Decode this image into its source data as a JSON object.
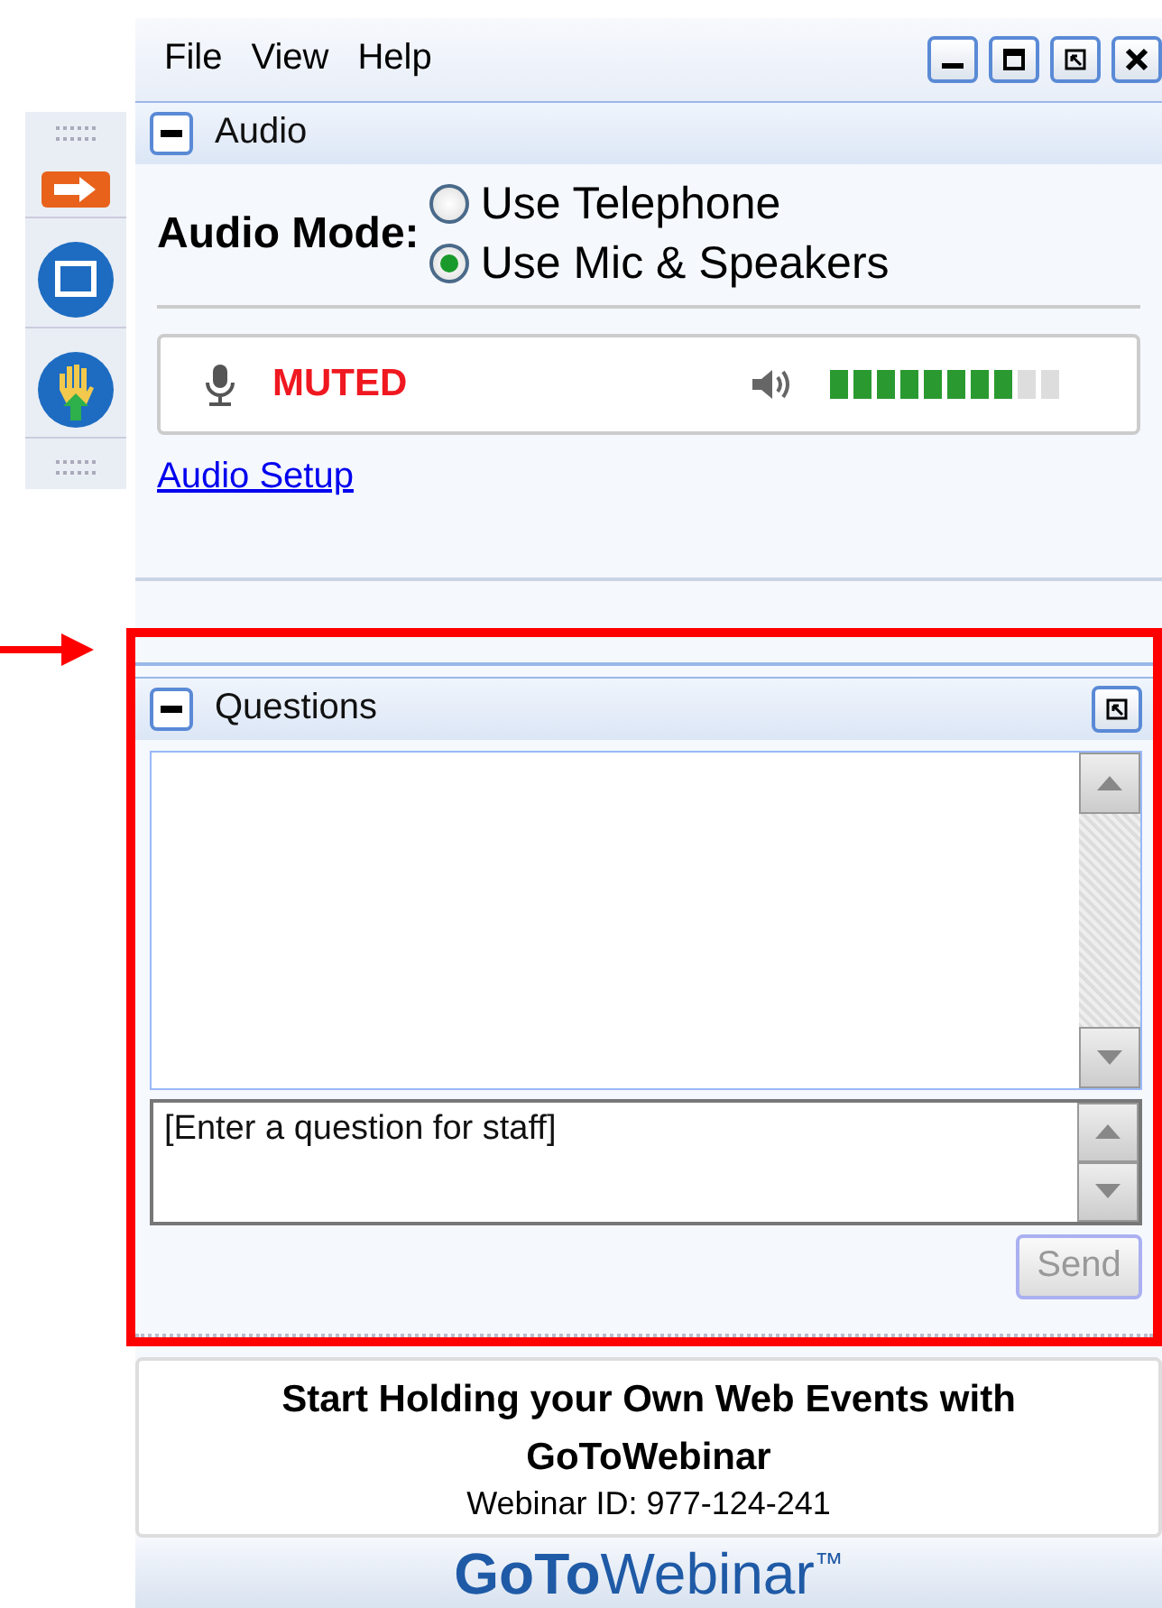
{
  "menu": [
    "File",
    "View",
    "Help"
  ],
  "audio": {
    "title": "Audio",
    "mode_label": "Audio Mode:",
    "modes": [
      {
        "label": "Use Telephone",
        "selected": false
      },
      {
        "label": "Use Mic & Speakers",
        "selected": true
      }
    ],
    "mic_status": "MUTED",
    "speaker": {
      "level": 0.8
    },
    "setup_link": "Audio Setup"
  },
  "questions": {
    "title": "Questions",
    "placeholder": "[Enter a question for staff]",
    "send": "Send",
    "send_disabled": true
  },
  "promo": {
    "headline": "Start Holding your Own Web Events with GoToWebinar",
    "webinar_id": "Webinar ID: 977-124-241"
  },
  "brand": {
    "bold": "GoTo",
    "light": "Webinar",
    "mark": "™"
  }
}
